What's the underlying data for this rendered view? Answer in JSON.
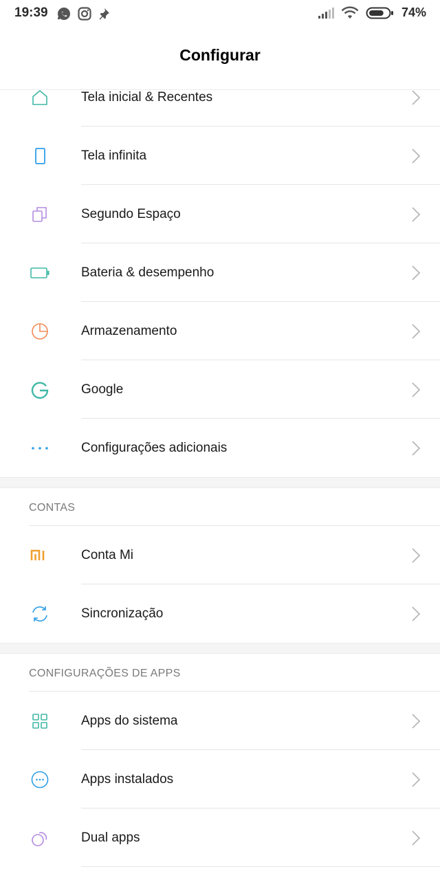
{
  "status_bar": {
    "time": "19:39",
    "left_icons": [
      "whatsapp-icon",
      "instagram-icon",
      "pin-icon"
    ],
    "battery_percent": "74%",
    "battery_level": 0.74
  },
  "header": {
    "title": "Configurar"
  },
  "sections": {
    "top": {
      "items": [
        {
          "label": "Tela inicial & Recentes",
          "icon": "home-icon",
          "color": "#3fb8a6"
        },
        {
          "label": "Tela infinita",
          "icon": "phone-icon",
          "color": "#2f9ee8"
        },
        {
          "label": "Segundo Espaço",
          "icon": "second-space-icon",
          "color": "#b48be0"
        },
        {
          "label": "Bateria & desempenho",
          "icon": "battery-icon",
          "color": "#3fb8a6"
        },
        {
          "label": "Armazenamento",
          "icon": "storage-pie-icon",
          "color": "#f08a55"
        },
        {
          "label": "Google",
          "icon": "google-g-icon",
          "color": "#3fb8a6"
        },
        {
          "label": "Configurações adicionais",
          "icon": "more-dots-icon",
          "color": "#2f9ee8"
        }
      ]
    },
    "contas": {
      "header": "CONTAS",
      "items": [
        {
          "label": "Conta Mi",
          "icon": "mi-logo-icon",
          "color": "#f0a030"
        },
        {
          "label": "Sincronização",
          "icon": "sync-icon",
          "color": "#2f9ee8"
        }
      ]
    },
    "apps": {
      "header": "CONFIGURAÇÕES DE APPS",
      "items": [
        {
          "label": "Apps do sistema",
          "icon": "grid-apps-icon",
          "color": "#3fb8a6"
        },
        {
          "label": "Apps instalados",
          "icon": "installed-apps-icon",
          "color": "#2f9ee8"
        },
        {
          "label": "Dual apps",
          "icon": "dual-apps-icon",
          "color": "#b48be0"
        }
      ]
    }
  }
}
